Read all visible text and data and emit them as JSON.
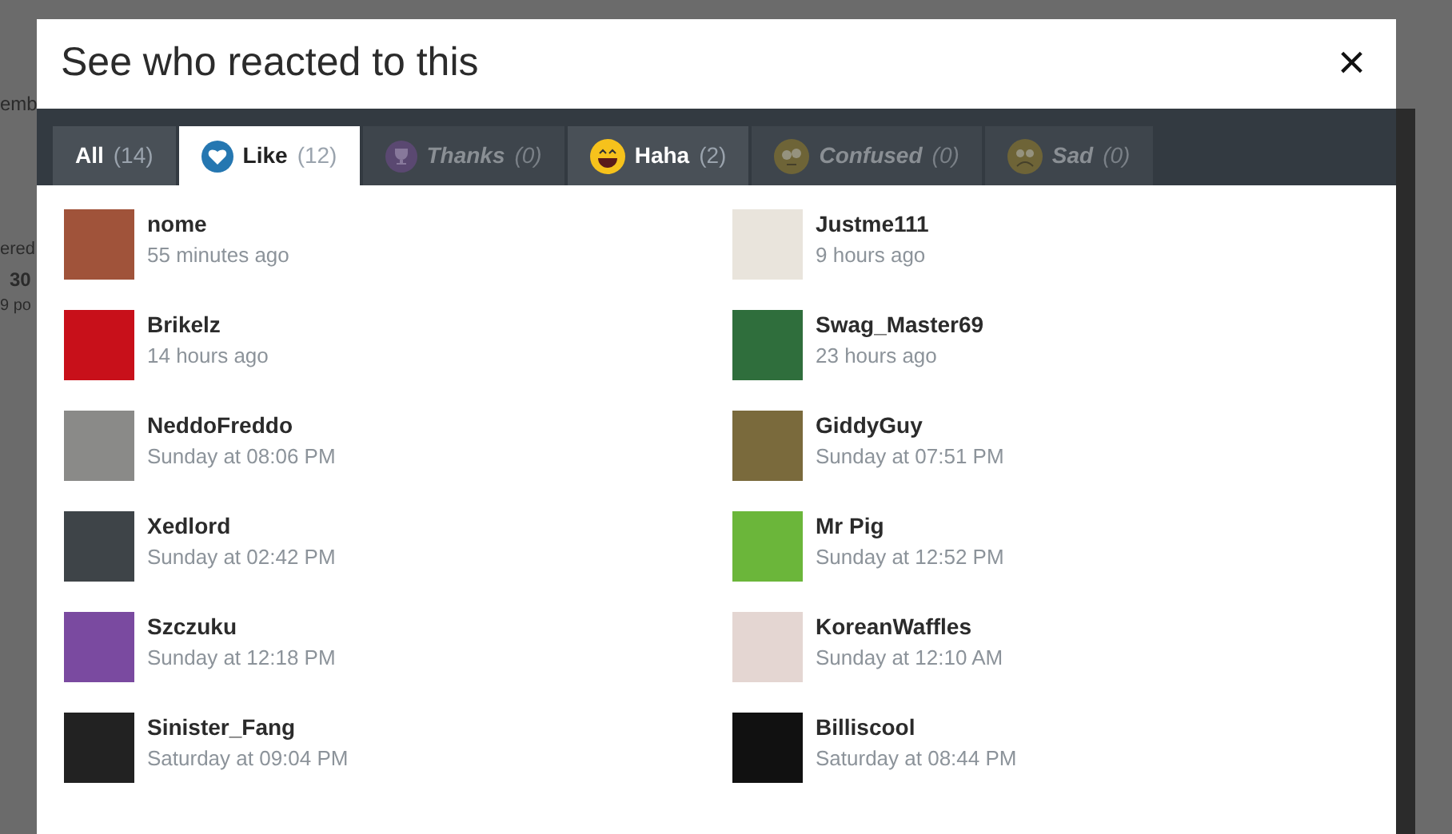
{
  "background": {
    "texts": [
      {
        "kind": "line",
        "text": "emb"
      },
      {
        "kind": "line",
        "text": "ered"
      },
      {
        "kind": "stat",
        "text": "30"
      },
      {
        "kind": "line",
        "text": "9 po"
      }
    ]
  },
  "dialog": {
    "title": "See who reacted to this",
    "close": "×"
  },
  "tabs": [
    {
      "label": "All",
      "count": "(14)",
      "kind": "all",
      "selected": false,
      "disabled": false
    },
    {
      "label": "Like",
      "count": "(12)",
      "kind": "heart",
      "selected": true,
      "disabled": false
    },
    {
      "label": "Thanks",
      "count": "(0)",
      "kind": "trophy",
      "selected": false,
      "disabled": true
    },
    {
      "label": "Haha",
      "count": "(2)",
      "kind": "laugh",
      "selected": false,
      "disabled": false
    },
    {
      "label": "Confused",
      "count": "(0)",
      "kind": "confused",
      "selected": false,
      "disabled": true
    },
    {
      "label": "Sad",
      "count": "(0)",
      "kind": "sad",
      "selected": false,
      "disabled": true
    }
  ],
  "users": [
    {
      "name": "nome",
      "time": "55 minutes ago",
      "color": "#a0533a"
    },
    {
      "name": "Justme111",
      "time": "9 hours ago",
      "color": "#e9e4dc"
    },
    {
      "name": "Brikelz",
      "time": "14 hours ago",
      "color": "#c8101a"
    },
    {
      "name": "Swag_Master69",
      "time": "23 hours ago",
      "color": "#2f6e3c"
    },
    {
      "name": "NeddoFreddo",
      "time": "Sunday at 08:06 PM",
      "color": "#8a8a88"
    },
    {
      "name": "GiddyGuy",
      "time": "Sunday at 07:51 PM",
      "color": "#7a6a3c"
    },
    {
      "name": "Xedlord",
      "time": "Sunday at 02:42 PM",
      "color": "#3e4448"
    },
    {
      "name": "Mr Pig",
      "time": "Sunday at 12:52 PM",
      "color": "#6bb63a"
    },
    {
      "name": "Szczuku",
      "time": "Sunday at 12:18 PM",
      "color": "#7a4aa0"
    },
    {
      "name": "KoreanWaffles",
      "time": "Sunday at 12:10 AM",
      "color": "#e4d6d2"
    },
    {
      "name": "Sinister_Fang",
      "time": "Saturday at 09:04 PM",
      "color": "#222222"
    },
    {
      "name": "Billiscool",
      "time": "Saturday at 08:44 PM",
      "color": "#111111"
    }
  ]
}
